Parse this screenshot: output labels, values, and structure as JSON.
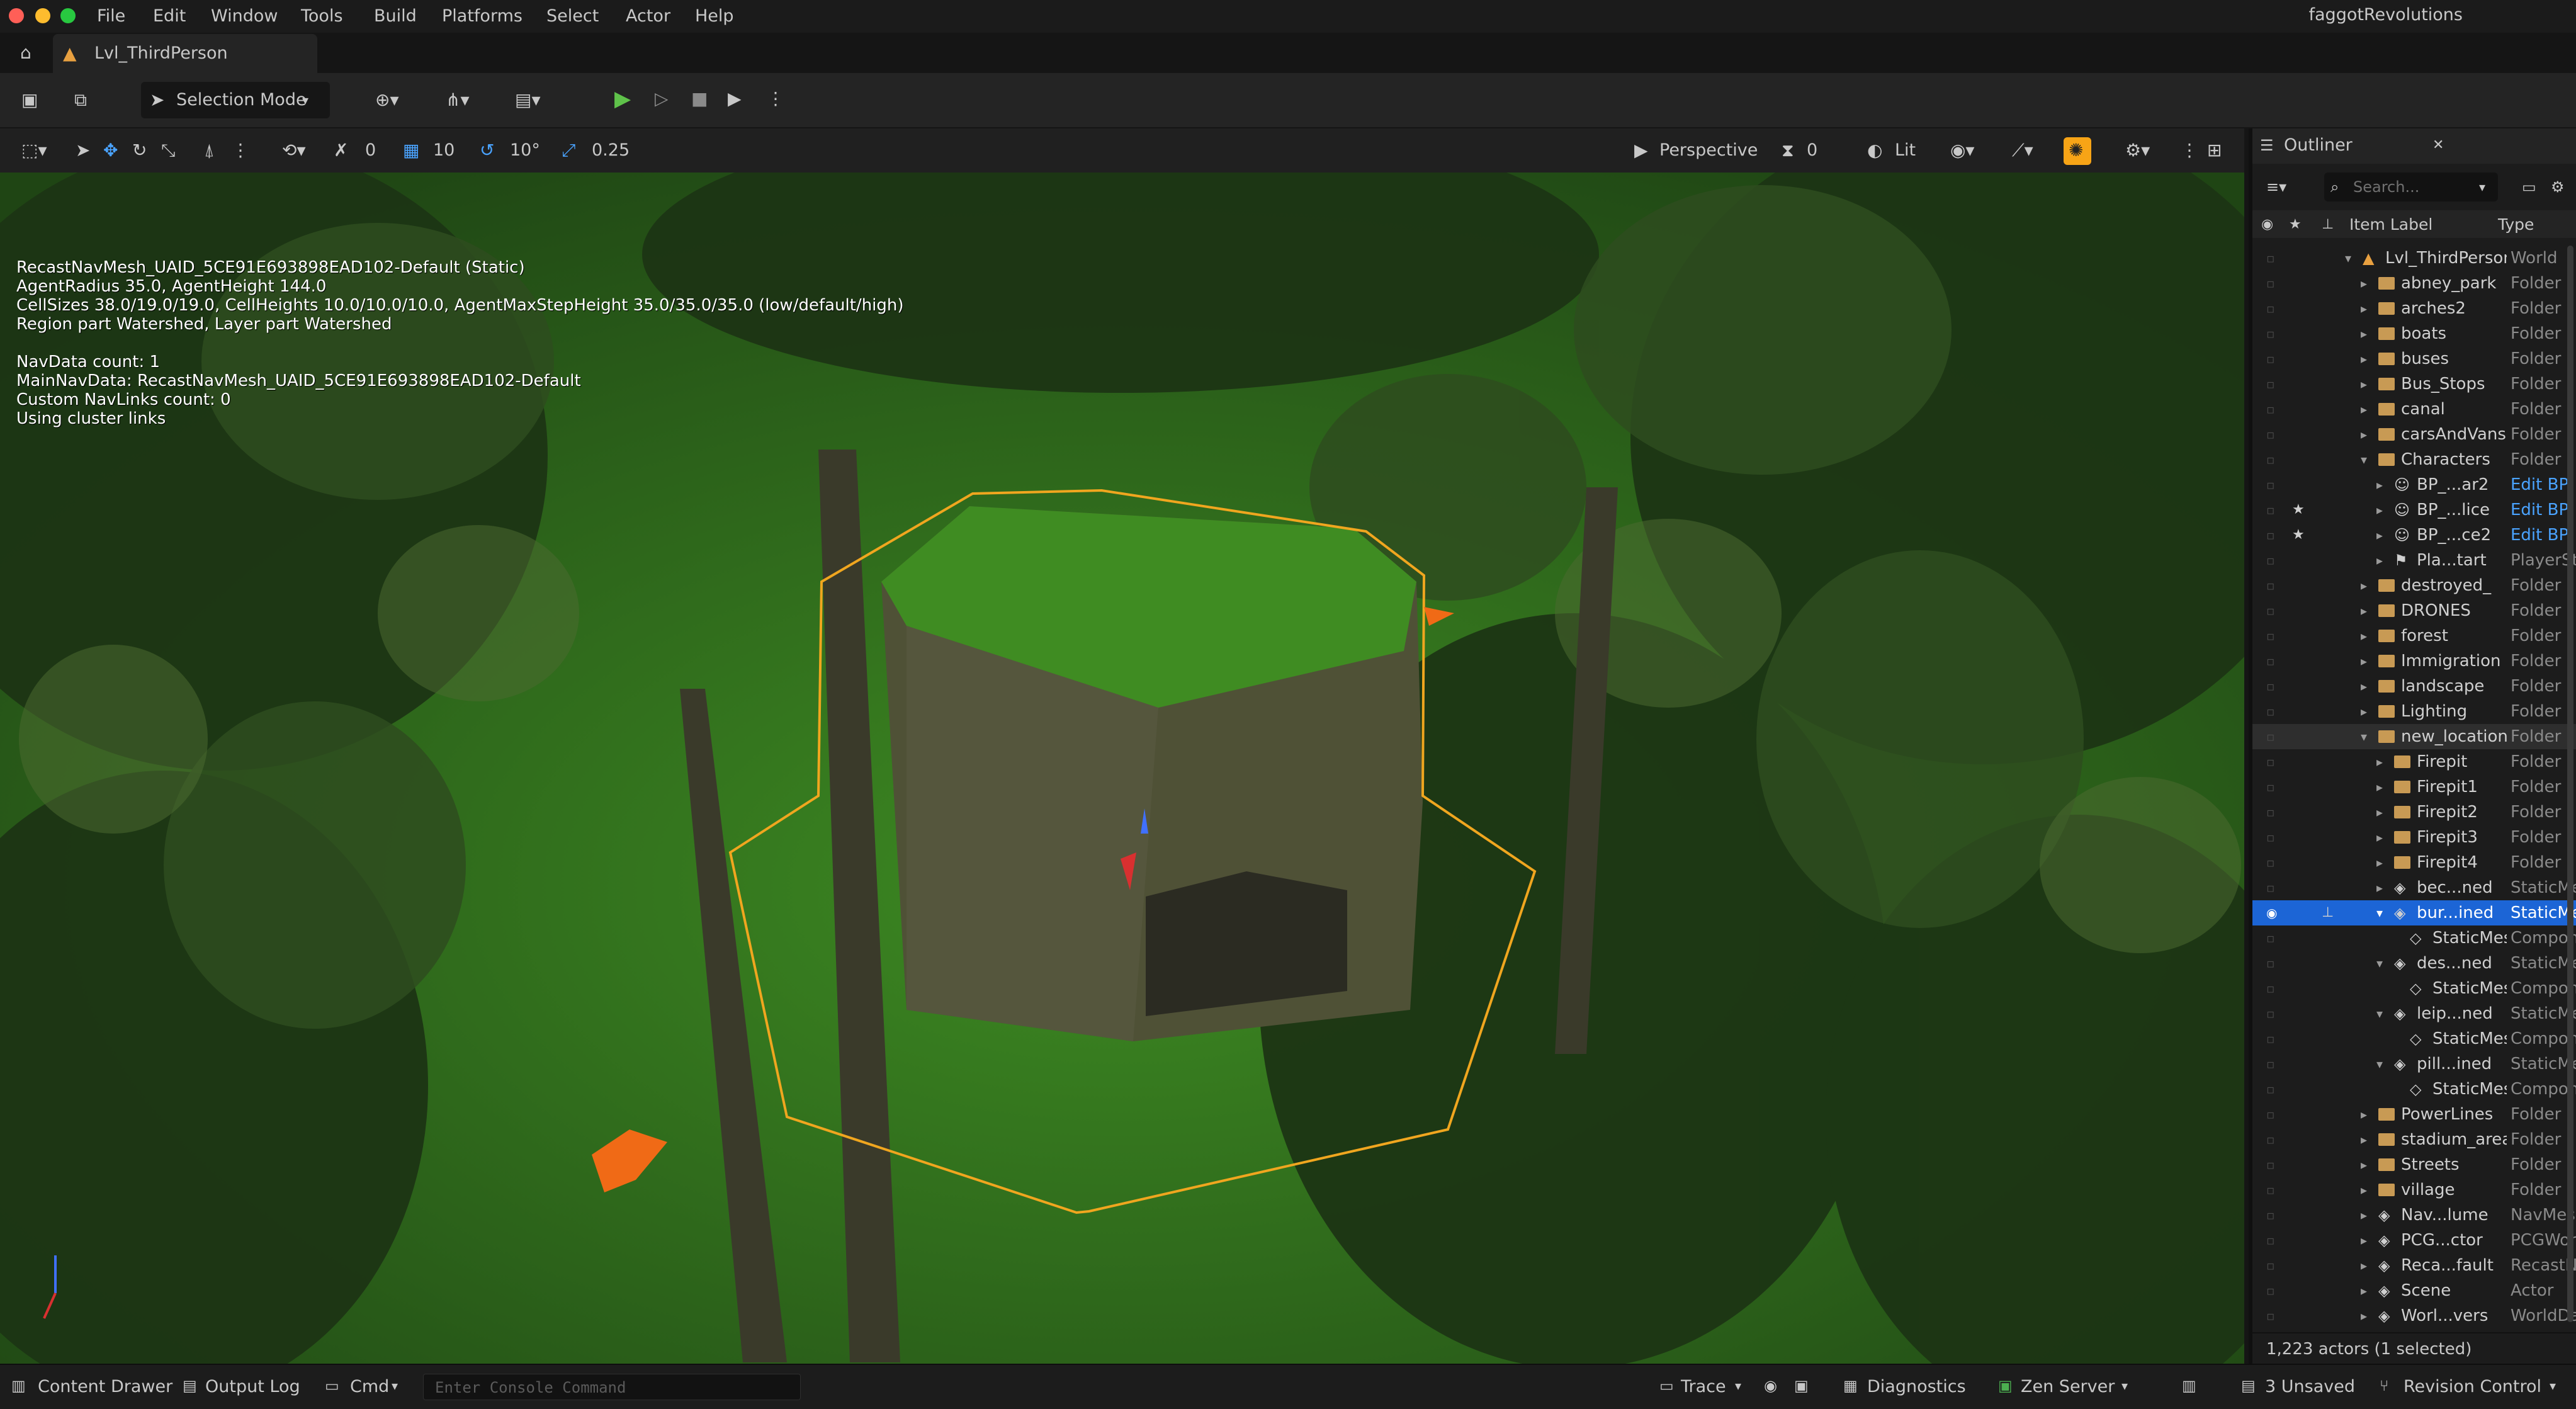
{
  "menubar": {
    "items": [
      "File",
      "Edit",
      "Window",
      "Tools",
      "Build",
      "Platforms",
      "Select",
      "Actor",
      "Help"
    ],
    "project": "faggotRevolutions"
  },
  "tab": {
    "level_name": "Lvl_ThirdPerson"
  },
  "toolbar": {
    "mode_label": "Selection Mode"
  },
  "viewport_toolbar": {
    "rotation_snap": "0",
    "grid_snap": "10",
    "angle_snap": "10°",
    "scale_snap": "0.25",
    "view_type": "Perspective",
    "camera_speed": "0",
    "view_mode": "Lit"
  },
  "overlay": {
    "lines": [
      "RecastNavMesh_UAID_5CE91E693898EAD102-Default (Static)",
      "AgentRadius 35.0, AgentHeight 144.0",
      "CellSizes 38.0/19.0/19.0, CellHeights 10.0/10.0/10.0, AgentMaxStepHeight 35.0/35.0/35.0 (low/default/high)",
      "Region part Watershed, Layer part Watershed",
      "",
      "NavData count: 1",
      "MainNavData: RecastNavMesh_UAID_5CE91E693898EAD102-Default",
      "Custom NavLinks count: 0",
      "Using cluster links"
    ]
  },
  "outliner": {
    "title": "Outliner",
    "search_placeholder": "Search...",
    "col_label": "Item Label",
    "col_type": "Type",
    "actor_count": "1,223 actors (1 selected)",
    "rows": [
      {
        "label": "Lvl_ThirdPerson",
        "type": "World",
        "kind": "world",
        "indent": 0,
        "expanded": true
      },
      {
        "label": "abney_park",
        "type": "Folder",
        "kind": "folder",
        "indent": 1
      },
      {
        "label": "arches2",
        "type": "Folder",
        "kind": "folder",
        "indent": 1
      },
      {
        "label": "boats",
        "type": "Folder",
        "kind": "folder",
        "indent": 1
      },
      {
        "label": "buses",
        "type": "Folder",
        "kind": "folder",
        "indent": 1
      },
      {
        "label": "Bus_Stops",
        "type": "Folder",
        "kind": "folder",
        "indent": 1
      },
      {
        "label": "canal",
        "type": "Folder",
        "kind": "folder",
        "indent": 1
      },
      {
        "label": "carsAndVans",
        "type": "Folder",
        "kind": "folder",
        "indent": 1
      },
      {
        "label": "Characters",
        "type": "Folder",
        "kind": "folder",
        "indent": 1,
        "expanded": true
      },
      {
        "label": "BP_...ar2",
        "type": "Edit BP",
        "kind": "char",
        "indent": 2
      },
      {
        "label": "BP_...lice",
        "type": "Edit BP",
        "kind": "char",
        "indent": 2,
        "star": true
      },
      {
        "label": "BP_...ce2",
        "type": "Edit BP",
        "kind": "char",
        "indent": 2,
        "star": true
      },
      {
        "label": "Pla...tart",
        "type": "PlayerStart",
        "kind": "flag",
        "indent": 2
      },
      {
        "label": "destroyed_",
        "type": "Folder",
        "kind": "folder",
        "indent": 1
      },
      {
        "label": "DRONES",
        "type": "Folder",
        "kind": "folder",
        "indent": 1
      },
      {
        "label": "forest",
        "type": "Folder",
        "kind": "folder",
        "indent": 1
      },
      {
        "label": "Immigration",
        "type": "Folder",
        "kind": "folder",
        "indent": 1
      },
      {
        "label": "landscape",
        "type": "Folder",
        "kind": "folder",
        "indent": 1
      },
      {
        "label": "Lighting",
        "type": "Folder",
        "kind": "folder",
        "indent": 1
      },
      {
        "label": "new_location",
        "type": "Folder",
        "kind": "folder",
        "indent": 1,
        "expanded": true,
        "hl": true
      },
      {
        "label": "Firepit",
        "type": "Folder",
        "kind": "folder",
        "indent": 2
      },
      {
        "label": "Firepit1",
        "type": "Folder",
        "kind": "folder",
        "indent": 2
      },
      {
        "label": "Firepit2",
        "type": "Folder",
        "kind": "folder",
        "indent": 2
      },
      {
        "label": "Firepit3",
        "type": "Folder",
        "kind": "folder",
        "indent": 2
      },
      {
        "label": "Firepit4",
        "type": "Folder",
        "kind": "folder",
        "indent": 2
      },
      {
        "label": "bec...ned",
        "type": "StaticMeshActor",
        "kind": "mesh",
        "indent": 2
      },
      {
        "label": "bur...ined",
        "type": "StaticMeshActor",
        "kind": "mesh",
        "indent": 2,
        "expanded": true,
        "selected": true
      },
      {
        "label": "StaticMeshComponent",
        "type": "Component",
        "kind": "comp",
        "indent": 3
      },
      {
        "label": "des...ned",
        "type": "StaticMeshActor",
        "kind": "mesh",
        "indent": 2,
        "expanded": true
      },
      {
        "label": "StaticMeshComponent",
        "type": "Component",
        "kind": "comp",
        "indent": 3
      },
      {
        "label": "leip...ned",
        "type": "StaticMeshActor",
        "kind": "mesh",
        "indent": 2,
        "expanded": true
      },
      {
        "label": "StaticMeshComponent",
        "type": "Component",
        "kind": "comp",
        "indent": 3
      },
      {
        "label": "pill...ined",
        "type": "StaticMeshActor",
        "kind": "mesh",
        "indent": 2,
        "expanded": true
      },
      {
        "label": "StaticMeshComponent",
        "type": "Component",
        "kind": "comp",
        "indent": 3
      },
      {
        "label": "PowerLines",
        "type": "Folder",
        "kind": "folder",
        "indent": 1
      },
      {
        "label": "stadium_area",
        "type": "Folder",
        "kind": "folder",
        "indent": 1
      },
      {
        "label": "Streets",
        "type": "Folder",
        "kind": "folder",
        "indent": 1
      },
      {
        "label": "village",
        "type": "Folder",
        "kind": "folder",
        "indent": 1
      },
      {
        "label": "Nav...lume",
        "type": "NavMeshBoundsVolume",
        "kind": "vol",
        "indent": 1
      },
      {
        "label": "PCG...ctor",
        "type": "PCGWorldActor",
        "kind": "vol",
        "indent": 1
      },
      {
        "label": "Reca...fault",
        "type": "RecastNavMesh",
        "kind": "vol",
        "indent": 1
      },
      {
        "label": "Scene",
        "type": "Actor",
        "kind": "vol",
        "indent": 1
      },
      {
        "label": "Worl...vers",
        "type": "WorldDataLayers",
        "kind": "vol",
        "indent": 1
      }
    ]
  },
  "statusbar": {
    "content_drawer": "Content Drawer",
    "output_log": "Output Log",
    "cmd": "Cmd",
    "console_placeholder": "Enter Console Command",
    "trace": "Trace",
    "diagnostics": "Diagnostics",
    "zen_server": "Zen Server",
    "unsaved": "3 Unsaved",
    "revision_control": "Revision Control"
  },
  "colors": {
    "accent_green": "#4caf50",
    "selection_blue": "#1c65d6",
    "folder": "#c89a54",
    "navmesh_green": "#3f8c22",
    "selection_outline": "#f0a61f"
  }
}
